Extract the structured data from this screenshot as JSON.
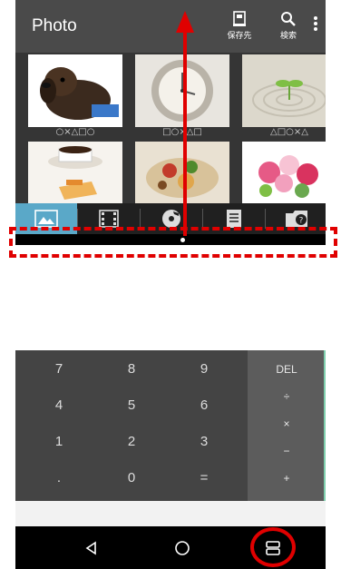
{
  "app_top": {
    "title": "Photo",
    "actions": [
      {
        "label": "保存先",
        "icon": "save-location-icon"
      },
      {
        "label": "検索",
        "icon": "search-icon"
      }
    ],
    "overflow_icon": "more-vert-icon",
    "thumbnails": [
      {
        "caption": "○×△□○",
        "subject": "dog"
      },
      {
        "caption": "□○×△□",
        "subject": "clock"
      },
      {
        "caption": "△□○×△",
        "subject": "sprout"
      },
      {
        "caption": "",
        "subject": "coffee"
      },
      {
        "caption": "",
        "subject": "food"
      },
      {
        "caption": "",
        "subject": "flowers"
      }
    ],
    "tabs": [
      {
        "icon": "photo-icon",
        "active": true
      },
      {
        "icon": "film-icon",
        "active": false
      },
      {
        "icon": "music-icon",
        "active": false
      },
      {
        "icon": "document-icon",
        "active": false
      },
      {
        "icon": "unknown-folder-icon",
        "active": false
      }
    ]
  },
  "calculator": {
    "keys": [
      "7",
      "8",
      "9",
      "4",
      "5",
      "6",
      "1",
      "2",
      "3",
      ".",
      "0",
      "="
    ],
    "ops": [
      "DEL",
      "÷",
      "×",
      "−",
      "+"
    ]
  },
  "navbar": {
    "back_icon": "back-icon",
    "home_icon": "home-icon",
    "recents_icon": "multi-window-icon"
  },
  "colors": {
    "annotation": "#e00000",
    "tab_active": "#5aa8c8",
    "calc_accent": "#7ecfae"
  }
}
